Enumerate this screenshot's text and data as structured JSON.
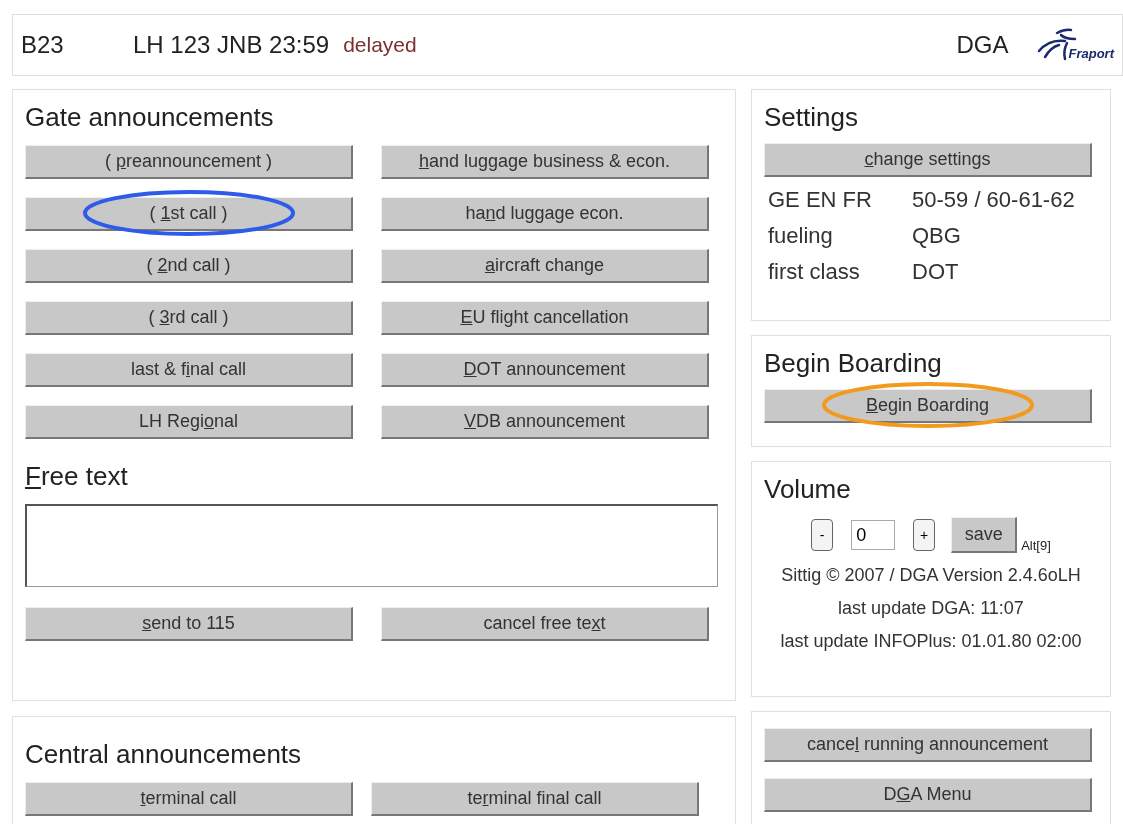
{
  "header": {
    "gate": "B23",
    "flight": "LH 123 JNB 23:59",
    "status": "delayed",
    "system": "DGA",
    "logo_text": "Fraport"
  },
  "gate_announcements": {
    "title": "Gate announcements",
    "buttons": [
      {
        "before": "( ",
        "key": "p",
        "after": "reannouncement )"
      },
      {
        "key": "h",
        "after": "and luggage business & econ."
      },
      {
        "before": "( ",
        "key": "1",
        "after": "st call )",
        "color": "#2f5bea"
      },
      {
        "before": "ha",
        "key": "n",
        "after": "d luggage econ."
      },
      {
        "before": "( ",
        "key": "2",
        "after": "nd call )"
      },
      {
        "key": "a",
        "after": "ircraft change"
      },
      {
        "before": "( ",
        "key": "3",
        "after": "rd call )"
      },
      {
        "key": "E",
        "after": "U flight cancellation"
      },
      {
        "before": "last & f",
        "key": "i",
        "after": "nal call"
      },
      {
        "key": "D",
        "after": "OT announcement"
      },
      {
        "before": "LH Regi",
        "key": "o",
        "after": "nal"
      },
      {
        "key": "V",
        "after": "DB announcement"
      }
    ]
  },
  "free_text": {
    "title_key": "F",
    "title_rest": "ree text",
    "buttons": [
      {
        "key": "s",
        "after": "end to 115"
      },
      {
        "before": "cancel free te",
        "key": "x",
        "after": "t"
      }
    ]
  },
  "central_announcements": {
    "title": "Central announcements",
    "buttons": [
      {
        "key": "t",
        "after": "erminal call"
      },
      {
        "before": "te",
        "key": "r",
        "after": "minal final call"
      }
    ]
  },
  "settings": {
    "title": "Settings",
    "button": {
      "key": "c",
      "after": "hange settings"
    },
    "rows": [
      {
        "label": "GE EN FR",
        "value": "50-59 / 60-61-62"
      },
      {
        "label": "fueling",
        "value": "QBG"
      },
      {
        "label": "first class",
        "value": "DOT"
      }
    ]
  },
  "boarding": {
    "title": "Begin Boarding",
    "button": {
      "key": "B",
      "after": "egin Boarding",
      "color": "#f39a1e"
    }
  },
  "volume": {
    "title": "Volume",
    "minus": "-",
    "value": "0",
    "plus": "+",
    "save": "save",
    "shortcut": "Alt[9]",
    "lines": [
      "Sittig © 2007 / DGA Version 2.4.6oLH",
      "last update DGA: 11:07",
      "last update INFOPlus: 01.01.80 02:00"
    ]
  },
  "actions": {
    "buttons": [
      {
        "before": "cance",
        "key": "l",
        "after": " running announcement"
      },
      {
        "before": "D",
        "key": "G",
        "after": "A Menu"
      }
    ]
  }
}
